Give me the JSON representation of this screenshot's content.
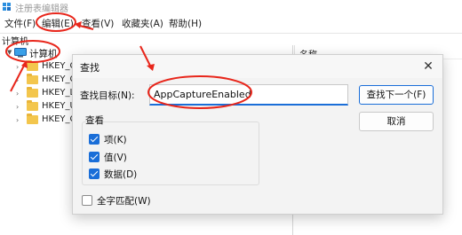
{
  "window": {
    "title": "注册表编辑器"
  },
  "menu": {
    "items": [
      "文件(F)",
      "编辑(E)",
      "查看(V)",
      "收藏夹(A)",
      "帮助(H)"
    ]
  },
  "address": {
    "path": "计算机"
  },
  "tree": {
    "root_label": "计算机",
    "nodes": [
      "HKEY_CL",
      "HKEY_CU",
      "HKEY_LO",
      "HKEY_US",
      "HKEY_CU"
    ]
  },
  "list": {
    "column_name": "名称"
  },
  "dialog": {
    "title": "查找",
    "close_glyph": "✕",
    "find_label": "查找目标(N):",
    "find_value": "AppCaptureEnabled",
    "find_next_label": "查找下一个(F)",
    "cancel_label": "取消",
    "look_at_label": "查看",
    "keys_label": "项(K)",
    "values_label": "值(V)",
    "data_label": "数据(D)",
    "match_whole_label": "全字匹配(W)",
    "keys_checked": true,
    "values_checked": true,
    "data_checked": true,
    "match_whole_checked": false
  },
  "colors": {
    "accent": "#1a6ed8",
    "annotation": "#e8261b"
  }
}
